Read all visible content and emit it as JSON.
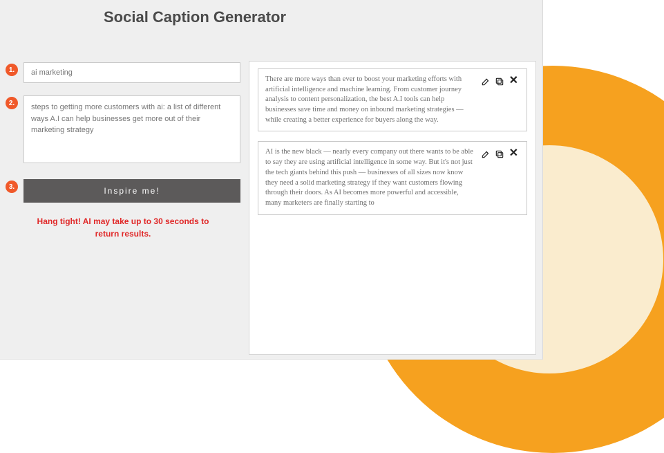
{
  "title": "Social Caption Generator",
  "steps": {
    "s1": {
      "badge": "1.",
      "value": "ai marketing",
      "placeholder": ""
    },
    "s2": {
      "badge": "2.",
      "value": "steps to getting more customers with ai: a list of different ways A.I can help businesses get more out of their marketing strategy",
      "placeholder": ""
    },
    "s3": {
      "badge": "3."
    }
  },
  "button": {
    "label": "Inspire me!"
  },
  "status": "Hang tight! AI may take up to 30 seconds to return results.",
  "results": [
    {
      "text": "There are more ways than ever to boost your marketing efforts with artificial intelligence and machine learning. From customer journey analysis to content personalization, the best A.I tools can help businesses save time and money on inbound marketing strategies — while creating a better experience for buyers along the way."
    },
    {
      "text": "AI is the new black — nearly every company out there wants to be able to say they are using artificial intelligence in some way. But it's not just the tech giants behind this push — businesses of all sizes now know they need a solid marketing strategy if they want customers flowing through their doors. As AI becomes more powerful and accessible, many marketers are finally starting to"
    }
  ],
  "icons": {
    "edit": "edit-icon",
    "copy": "copy-icon",
    "close": "close-icon"
  }
}
